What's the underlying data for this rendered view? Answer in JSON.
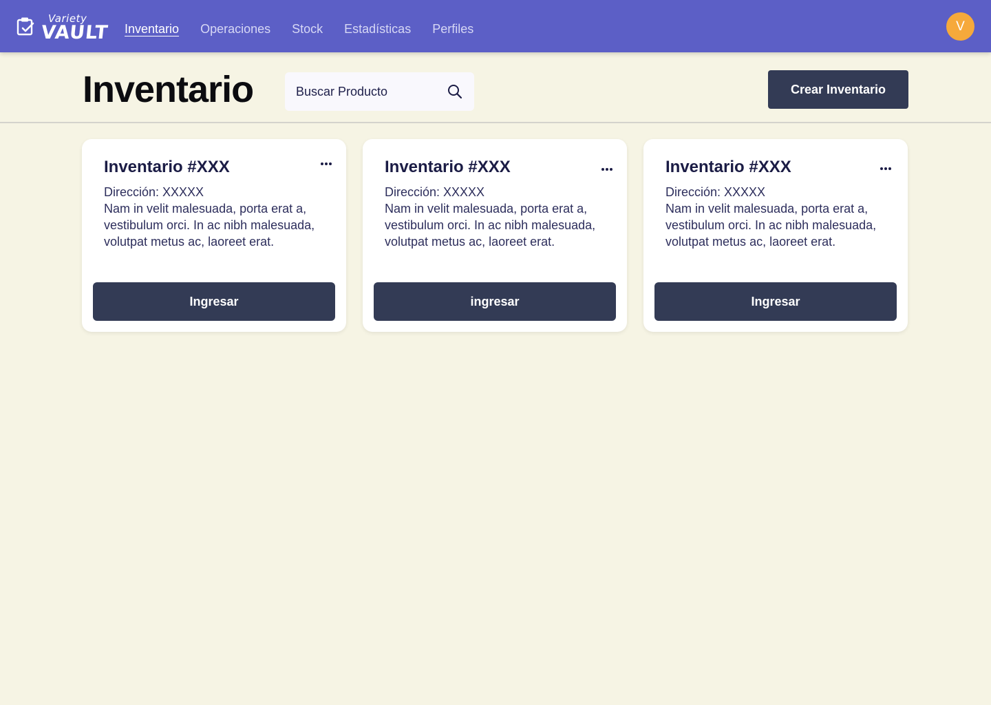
{
  "brand": {
    "small": "Variety",
    "big": "VAULT",
    "icon": "clipboard-check-icon"
  },
  "nav": {
    "items": [
      {
        "label": "Inventario",
        "active": true
      },
      {
        "label": "Operaciones",
        "active": false
      },
      {
        "label": "Stock",
        "active": false
      },
      {
        "label": "Estadísticas",
        "active": false
      },
      {
        "label": "Perfiles",
        "active": false
      }
    ]
  },
  "user": {
    "avatar_initial": "V",
    "avatar_color": "#f6a93b"
  },
  "header": {
    "title": "Inventario",
    "search_placeholder": "Buscar Producto",
    "search_icon": "search-icon",
    "create_label": "Crear Inventario"
  },
  "cards": [
    {
      "title": "Inventario #XXX",
      "address": "Dirección: XXXXX",
      "description": "Nam in velit malesuada, porta erat a, vestibulum orci. In ac nibh malesuada, volutpat metus ac, laoreet erat.",
      "button": "Ingresar",
      "menu_icon": "more-horizontal-icon"
    },
    {
      "title": "Inventario #XXX",
      "address": "Dirección: XXXXX",
      "description": "Nam in velit malesuada, porta erat a, vestibulum orci. In ac nibh malesuada, volutpat metus ac, laoreet erat.",
      "button": "ingresar",
      "menu_icon": "more-horizontal-icon"
    },
    {
      "title": "Inventario #XXX",
      "address": "Dirección: XXXXX",
      "description": "Nam in velit malesuada, porta erat a, vestibulum orci. In ac nibh malesuada, volutpat metus ac, laoreet erat.",
      "button": "Ingresar",
      "menu_icon": "more-horizontal-icon"
    }
  ],
  "colors": {
    "topbar": "#5c5fc6",
    "background": "#f6f4e4",
    "button": "#333b55",
    "text": "#1e1f4a"
  }
}
